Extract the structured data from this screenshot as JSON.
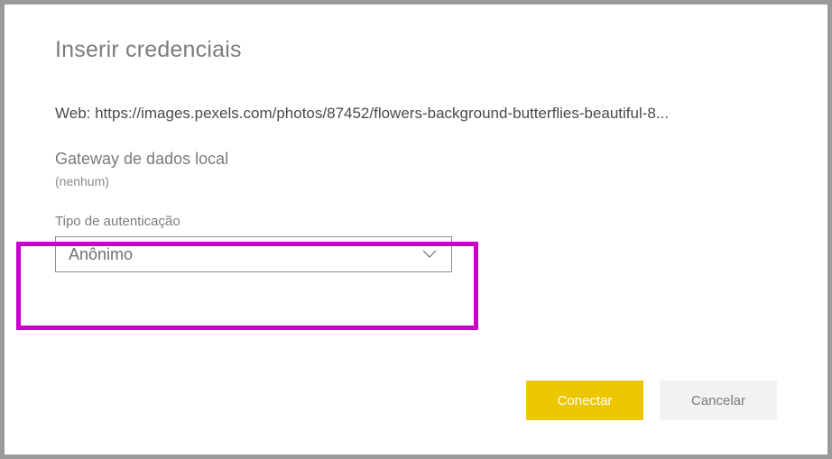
{
  "dialog": {
    "title": "Inserir credenciais"
  },
  "source": {
    "prefix": "Web: ",
    "url": "https://images.pexels.com/photos/87452/flowers-background-butterflies-beautiful-8..."
  },
  "gateway": {
    "label": "Gateway de dados local",
    "value": "(nenhum)"
  },
  "auth": {
    "label": "Tipo de autenticação",
    "selected": "Anônimo"
  },
  "buttons": {
    "connect": "Conectar",
    "cancel": "Cancelar"
  }
}
